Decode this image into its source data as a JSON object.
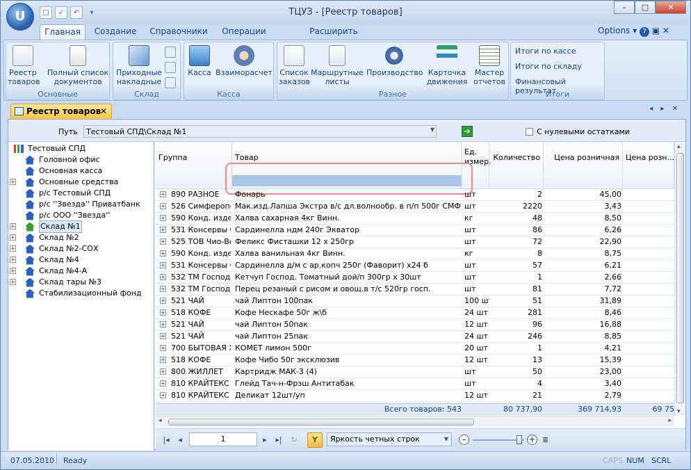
{
  "window": {
    "title": "ТЦУЗ - [Реестр товаров]",
    "orb_label": "U",
    "min": "–",
    "max": "□",
    "close": "✕"
  },
  "qat": [
    "□",
    "✓",
    "↶",
    "▾"
  ],
  "tabs": [
    {
      "label": "Главная",
      "active": true
    },
    {
      "label": "Создание"
    },
    {
      "label": "Справочники"
    },
    {
      "label": "Операции"
    },
    {
      "label": "Расширить возможности..."
    }
  ],
  "options_label": "Options",
  "options_help": "?",
  "ribbon": {
    "groups": [
      {
        "label": "Основные",
        "buttons": [
          {
            "line1": "Реестр",
            "line2": "товаров",
            "icon": "registry-icon"
          },
          {
            "line1": "Полный список",
            "line2": "документов",
            "icon": "document-list-icon"
          }
        ]
      },
      {
        "label": "Склад",
        "buttons": [
          {
            "line1": "Приходные",
            "line2": "накладные",
            "icon": "incoming-invoice-icon"
          }
        ]
      },
      {
        "label": "Касса",
        "buttons": [
          {
            "line1": "Касса",
            "line2": "",
            "icon": "cash-icon"
          },
          {
            "line1": "Взаиморасчет",
            "line2": "",
            "icon": "settlement-icon"
          }
        ]
      },
      {
        "label": "Разное",
        "buttons": [
          {
            "line1": "Список",
            "line2": "заказов",
            "icon": "order-list-icon"
          },
          {
            "line1": "Маршрутные",
            "line2": "листы",
            "icon": "route-sheet-icon"
          },
          {
            "line1": "Производство",
            "line2": "",
            "icon": "gear-icon"
          },
          {
            "line1": "Карточка",
            "line2": "движения",
            "icon": "movement-card-icon"
          },
          {
            "line1": "Мастер",
            "line2": "отчетов",
            "icon": "report-master-icon"
          }
        ]
      },
      {
        "label": "Итоги",
        "links": [
          "Итоги по кассе",
          "Итоги по складу",
          "Финансовый результат"
        ]
      }
    ]
  },
  "doc_tab": {
    "label": "Реестр товаров",
    "close": "✕",
    "nav": "◂ ▸ ✕"
  },
  "path": {
    "label": "Путь",
    "value": "Тестовый СПД\\Склад №1",
    "go": "➔",
    "zero_checkbox": "С нулевыми остатками"
  },
  "tree": [
    {
      "label": "Тестовый СПД",
      "icon": "bar-chart-icon",
      "level": 0
    },
    {
      "label": "Головной офис",
      "icon": "house-icon",
      "level": 1
    },
    {
      "label": "Основная касса",
      "icon": "house-icon",
      "level": 1
    },
    {
      "label": "Основные средства",
      "icon": "house-icon",
      "level": 1,
      "expand": true
    },
    {
      "label": "р/с  Тестовый СПД",
      "icon": "house-icon",
      "level": 1
    },
    {
      "label": "р/с ''Звезда'' Приватбанк",
      "icon": "house-icon",
      "level": 1
    },
    {
      "label": "р/с ООО ''Звезда''",
      "icon": "house-icon",
      "level": 1
    },
    {
      "label": "Склад №1",
      "icon": "house-green-icon",
      "level": 1,
      "expand": true,
      "selected": true
    },
    {
      "label": "Склад №2",
      "icon": "house-icon",
      "level": 1,
      "expand": true
    },
    {
      "label": "Склад №2-СОХ",
      "icon": "house-icon",
      "level": 1,
      "expand": true
    },
    {
      "label": "Склад №4",
      "icon": "house-icon",
      "level": 1,
      "expand": true
    },
    {
      "label": "Склад №4-А",
      "icon": "house-icon",
      "level": 1,
      "expand": true
    },
    {
      "label": "Склад тары №3",
      "icon": "house-icon",
      "level": 1,
      "expand": true
    },
    {
      "label": "Стабилизационный фонд",
      "icon": "house-icon",
      "level": 1
    }
  ],
  "columns": {
    "group": "Группа",
    "product": "Товар",
    "unit1": "Ед.",
    "unit2": "измер.",
    "qty": "Количество",
    "retail": "Цена розничная",
    "retail2": "Цена розн..."
  },
  "rows": [
    {
      "group": "890 РАЗНОЕ",
      "product": "Фонарь",
      "unit": "шт",
      "qty": "2",
      "price": "45,00"
    },
    {
      "group": "526 Симферопол",
      "product": "Мак.изд.Лапша Экстра  в/с дл.волнообр. в п/п  500г СМФ х10шт",
      "unit": "шт",
      "qty": "2220",
      "price": "3,43"
    },
    {
      "group": "590 Конд. издели",
      "product": "Халва сахарная 4кг Винн.",
      "unit": "кг",
      "qty": "48",
      "price": "8,50"
    },
    {
      "group": "531 Консервы Ов",
      "product": "Сардинелла ндм  240г  Экватор",
      "unit": "шт",
      "qty": "86",
      "price": "6,26"
    },
    {
      "group": "525 ТОВ Чио-Вол",
      "product": "Феликс Фисташки 12 х 250гр",
      "unit": "шт",
      "qty": "72",
      "price": "22,90"
    },
    {
      "group": "590 Конд. издели",
      "product": "Халва ванильная 4кг Винн.",
      "unit": "кг",
      "qty": "8",
      "price": "8,75"
    },
    {
      "group": "531 Консервы Ов",
      "product": "Сардинелла д/м с ар.копч 250г (Фаворит) х24 б",
      "unit": "шт",
      "qty": "57",
      "price": "6,21"
    },
    {
      "group": "532 ТМ Господар",
      "product": "Кетчуп Господ. Томатный дой/п 300гр х 30шт",
      "unit": "шт",
      "qty": "1",
      "price": "2,66"
    },
    {
      "group": "532 ТМ Господар",
      "product": "Перец резаный с рисом и овощ.в т/с 520гр госп.",
      "unit": "шт",
      "qty": "81",
      "price": "7,72"
    },
    {
      "group": "521 ЧАЙ",
      "product": "чай Липтон 100пак",
      "unit": "100 шт",
      "qty": "51",
      "price": "31,89"
    },
    {
      "group": "518 КОФЕ",
      "product": "Кофе Нескафе 50г ж\\б",
      "unit": "24  шт",
      "qty": "281",
      "price": "8,46"
    },
    {
      "group": "521 ЧАЙ",
      "product": "чай Липтон 50пак",
      "unit": "12 шт",
      "qty": "96",
      "price": "16,88"
    },
    {
      "group": "521 ЧАЙ",
      "product": "чай Липтон 25пак",
      "unit": "24 шт",
      "qty": "246",
      "price": "8,85"
    },
    {
      "group": "700 БЫТОВАЯ ХИ",
      "product": "КОМЕТ  лимон  500г",
      "unit": "20  шт",
      "qty": "1",
      "price": "4,21"
    },
    {
      "group": "518 КОФЕ",
      "product": "Кофе Чибо 50г эксклюзив",
      "unit": "12 шт",
      "qty": "13",
      "price": "15,39"
    },
    {
      "group": "800 ЖИЛЛЕТ",
      "product": "Картридж  МАК-3  (4)",
      "unit": "шт",
      "qty": "50",
      "price": "23,00"
    },
    {
      "group": "810 КРАЙТЕКС",
      "product": "Глейд Тач-н-Фрэш Антитабак",
      "unit": "шт",
      "qty": "4",
      "price": "3,40"
    },
    {
      "group": "810 КРАЙТЕКС",
      "product": "Деликат 12шт/уп",
      "unit": "12 шт",
      "qty": "21",
      "price": "2,79"
    }
  ],
  "footer": {
    "total_label": "Всего товаров: 543",
    "qty_total": "80 737,90",
    "retail_total": "369 714,93",
    "retail2_total": "69 75"
  },
  "navigator": {
    "page": "1",
    "brightness": "Яркость четных строк",
    "first": "|◂",
    "prev": "◂",
    "next": "▸",
    "last": "▸|",
    "refresh": "↻",
    "filter": "Y",
    "zoom_minus": "–",
    "zoom_plus": "+",
    "zoom_level": 0.9
  },
  "status": {
    "date": "07.05.2010",
    "state": "Ready",
    "caps": "CAPS",
    "num": "NUM",
    "scrl": "SCRL"
  }
}
